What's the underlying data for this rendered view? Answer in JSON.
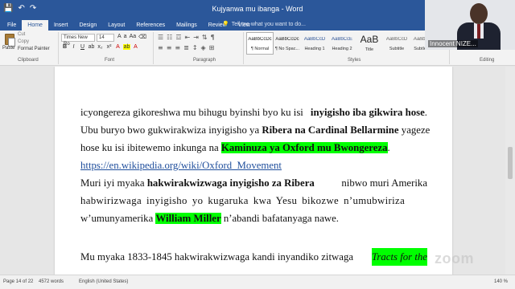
{
  "window": {
    "title": "Kujyanwa mu ibanga - Word",
    "tell_me": "Tell me what you want to do..."
  },
  "quick_access": {
    "save_icon": "save-icon",
    "undo_label": "↶",
    "redo_label": "↷"
  },
  "tabs": [
    "File",
    "Home",
    "Insert",
    "Design",
    "Layout",
    "References",
    "Mailings",
    "Review",
    "View"
  ],
  "ribbon": {
    "clipboard": {
      "paste_label": "Paste",
      "cut_label": "Cut",
      "copy_label": "Copy",
      "format_painter_label": "Format Painter",
      "group_label": "Clipboard"
    },
    "font": {
      "family": "Times New Ro",
      "size": "14",
      "group_label": "Font"
    },
    "paragraph": {
      "group_label": "Paragraph"
    },
    "styles": {
      "items": [
        {
          "preview": "AaBbCcDc",
          "name": "¶ Normal"
        },
        {
          "preview": "AaBbCcDc",
          "name": "¶ No Spac..."
        },
        {
          "preview": "AaBbCcD",
          "name": "Heading 1"
        },
        {
          "preview": "AaBbCcE",
          "name": "Heading 2"
        },
        {
          "preview": "AaB",
          "name": "Title"
        },
        {
          "preview": "AaBbCcD",
          "name": "Subtitle"
        },
        {
          "preview": "AaBbCcD",
          "name": "Subtle E..."
        }
      ],
      "group_label": "Styles"
    },
    "editing": {
      "group_label": "Editing"
    }
  },
  "document": {
    "p1": {
      "l1": [
        "icyongereza gikoreshwa mu bihugu byinshi byo ku isi ",
        "inyigisho iba gikwira hose",
        "."
      ],
      "l2": [
        "Ubu buryo bwo gukwirakwiza inyigisho ya ",
        "Ribera na Cardinal Bellarmine",
        " yageze"
      ],
      "l3": [
        "hose ku isi ibitewemo inkunga na ",
        "Kaminuza ya Oxford mu Bwongereza",
        "."
      ],
      "link": "https://en.wikipedia.org/wiki/Oxford_Movement"
    },
    "p2": {
      "l1": [
        "Muri iyi myaka ",
        "hakwirakwizwaga inyigisho za Ribera",
        " nibwo muri Amerika"
      ],
      "l2": "habwirizwaga inyigisho yo kugaruka kwa Yesu bikozwe n’umubwiriza",
      "l3": [
        "w’umunyamerika ",
        "William Miller",
        " n’abandi bafatanyaga nawe."
      ]
    },
    "p3": {
      "l1": [
        "Mu myaka 1833-1845 hakwirakwizwaga kandi inyandiko zitwaga ",
        "Tracts for the"
      ]
    }
  },
  "status": {
    "page": "Page 14 of 22",
    "words": "4572 words",
    "language": "English (United States)",
    "zoom": "140 %"
  },
  "video": {
    "participant_name": "Innocent NIZE...",
    "watermark": "zoom"
  },
  "colors": {
    "title_bar": "#2b579a",
    "highlight": "#00ff00",
    "link": "#1f4e9c"
  }
}
